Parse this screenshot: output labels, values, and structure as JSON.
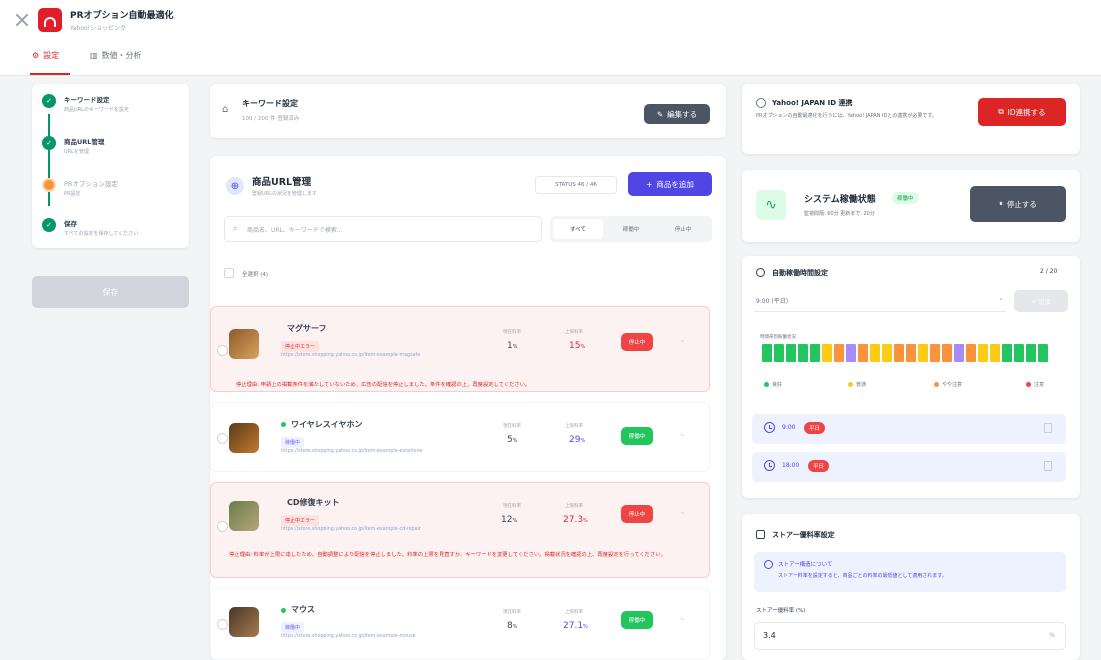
{
  "app": {
    "title": "PRオプション自動最適化",
    "subtitle": "Yahoo!ショッピング"
  },
  "tabs": [
    {
      "label": "設定"
    },
    {
      "label": "数値・分析"
    }
  ],
  "stepper": {
    "steps": [
      {
        "title": "キーワード設定",
        "desc": "商品URLのキーワードを設定"
      },
      {
        "title": "商品URL管理",
        "desc": "URLを管理"
      },
      {
        "title": "PRオプション設定",
        "desc": "PR設定"
      },
      {
        "title": "保存",
        "desc": "すべての設定を保存してください"
      }
    ],
    "save_label": "保存"
  },
  "keyword": {
    "title": "キーワード設定",
    "count": "100 / 200 件 登録済み",
    "button": "編集する"
  },
  "url_mgmt": {
    "title": "商品URL管理",
    "subtitle": "登録URLの状況を管理します",
    "status_text": "STATUS 46 / 46",
    "add_button": "商品を追加",
    "search_placeholder": "商品名、URL、キーワードで検索...",
    "filters": [
      "すべて",
      "稼働中",
      "停止中"
    ],
    "select_all": "全選択 (4)"
  },
  "products": [
    {
      "name": "マグサーフ",
      "badge": "停止中エラー",
      "url": "https://store.shopping.yahoo.co.jp/item-example-magsafe",
      "cur_label": "現在料率",
      "cur_value": "1",
      "cur_unit": "%",
      "max_label": "上限料率",
      "max_value": "15",
      "max_unit": "%",
      "status": "停止中",
      "error": "停止理由: 申請上の掲載条件を満たしていないため、広告の配信を停止しました。条件を確認の上、再度設定してください。"
    },
    {
      "name": "ワイヤレスイヤホン",
      "badge": "稼働中",
      "url": "https://store.shopping.yahoo.co.jp/item-example-earphone",
      "cur_label": "現在料率",
      "cur_value": "5",
      "cur_unit": "%",
      "max_label": "上限料率",
      "max_value": "29",
      "max_unit": "%",
      "status": "稼働中",
      "error": ""
    },
    {
      "name": "CD修復キット",
      "badge": "停止中エラー",
      "url": "https://store.shopping.yahoo.co.jp/item-example-cd-repair",
      "cur_label": "現在料率",
      "cur_value": "12",
      "cur_unit": "%",
      "max_label": "上限料率",
      "max_value": "27.3",
      "max_unit": "%",
      "status": "停止中",
      "error": "停止理由: 料率が上限に達したため、自動調整により配信を停止しました。料率の上限を見直すか、キーワードを変更してください。掲載状況を確認の上、再度設定を行ってください。"
    },
    {
      "name": "マウス",
      "badge": "稼働中",
      "url": "https://store.shopping.yahoo.co.jp/item-example-mouse",
      "cur_label": "現在料率",
      "cur_value": "8",
      "cur_unit": "%",
      "max_label": "上限料率",
      "max_value": "27.1",
      "max_unit": "%",
      "status": "稼働中",
      "error": ""
    }
  ],
  "yahoo": {
    "title": "Yahoo! JAPAN ID 連携",
    "desc": "PRオプションの自動最適化を行うには、Yahoo! JAPAN IDとの連携が必要です。",
    "button": "ID連携する"
  },
  "system": {
    "title": "システム稼働状態",
    "badge": "稼働中",
    "meta": "監視間隔: 60分  更新まで: 20分",
    "button": "停止する"
  },
  "schedule": {
    "title": "自動稼働時間設定",
    "count": "2 / 20",
    "select": "9:00 (平日)",
    "add_button": "+ 追加",
    "grid_label": "時間帯別稼働状況",
    "legend": [
      "良好",
      "普通",
      "やや注意",
      "注意"
    ],
    "times": [
      {
        "time": "9:00",
        "tag": "平日"
      },
      {
        "time": "18:00",
        "tag": "平日"
      }
    ]
  },
  "colors": {
    "green": "#22c55e",
    "yellow": "#facc15",
    "orange": "#fb923c",
    "red": "#ef4444",
    "purple": "#a78bfa"
  },
  "store": {
    "title": "ストアー優料率設定",
    "info_title": "ストアー構造について",
    "info_desc": "ストアー料率を設定すると、商品ごとの料率の最低値として適用されます。",
    "label": "ストアー優料率 (%)",
    "value": "3.4",
    "unit": "%"
  }
}
